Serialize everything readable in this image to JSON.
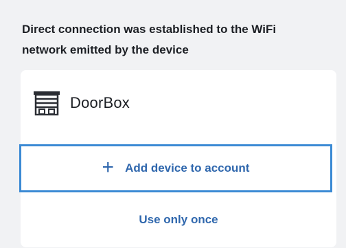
{
  "message": {
    "line1": "Direct connection was established to the WiFi",
    "line2": "network emitted by the device"
  },
  "device": {
    "icon": "garage-door-icon",
    "name": "DoorBox"
  },
  "actions": {
    "add_icon": "+",
    "add_label": "Add device to account",
    "once_label": "Use only once"
  },
  "colors": {
    "accent": "#2f67ad",
    "button_border": "#3b8ad4",
    "background": "#f1f2f4",
    "card": "#ffffff"
  }
}
